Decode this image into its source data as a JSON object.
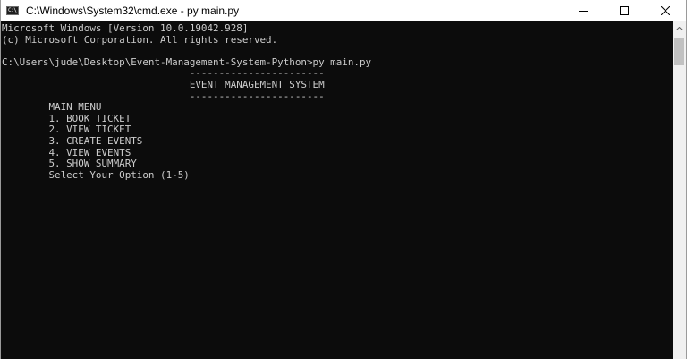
{
  "window": {
    "title": "C:\\Windows\\System32\\cmd.exe - py  main.py",
    "icon": "cmd-icon",
    "icon_text": "C:\\"
  },
  "caption_buttons": {
    "minimize": "minimize-icon",
    "maximize": "maximize-icon",
    "close": "close-icon"
  },
  "console": {
    "lines": [
      "Microsoft Windows [Version 10.0.19042.928]",
      "(c) Microsoft Corporation. All rights reserved.",
      "",
      "C:\\Users\\jude\\Desktop\\Event-Management-System-Python>py main.py",
      "                                -----------------------",
      "                                EVENT MANAGEMENT SYSTEM",
      "                                -----------------------",
      "        MAIN MENU",
      "        1. BOOK TICKET",
      "        2. VIEW TICKET",
      "        3. CREATE EVENTS",
      "        4. VIEW EVENTS",
      "        5. SHOW SUMMARY",
      "        Select Your Option (1-5)"
    ],
    "text_color": "#cccccc",
    "background": "#0c0c0c"
  }
}
